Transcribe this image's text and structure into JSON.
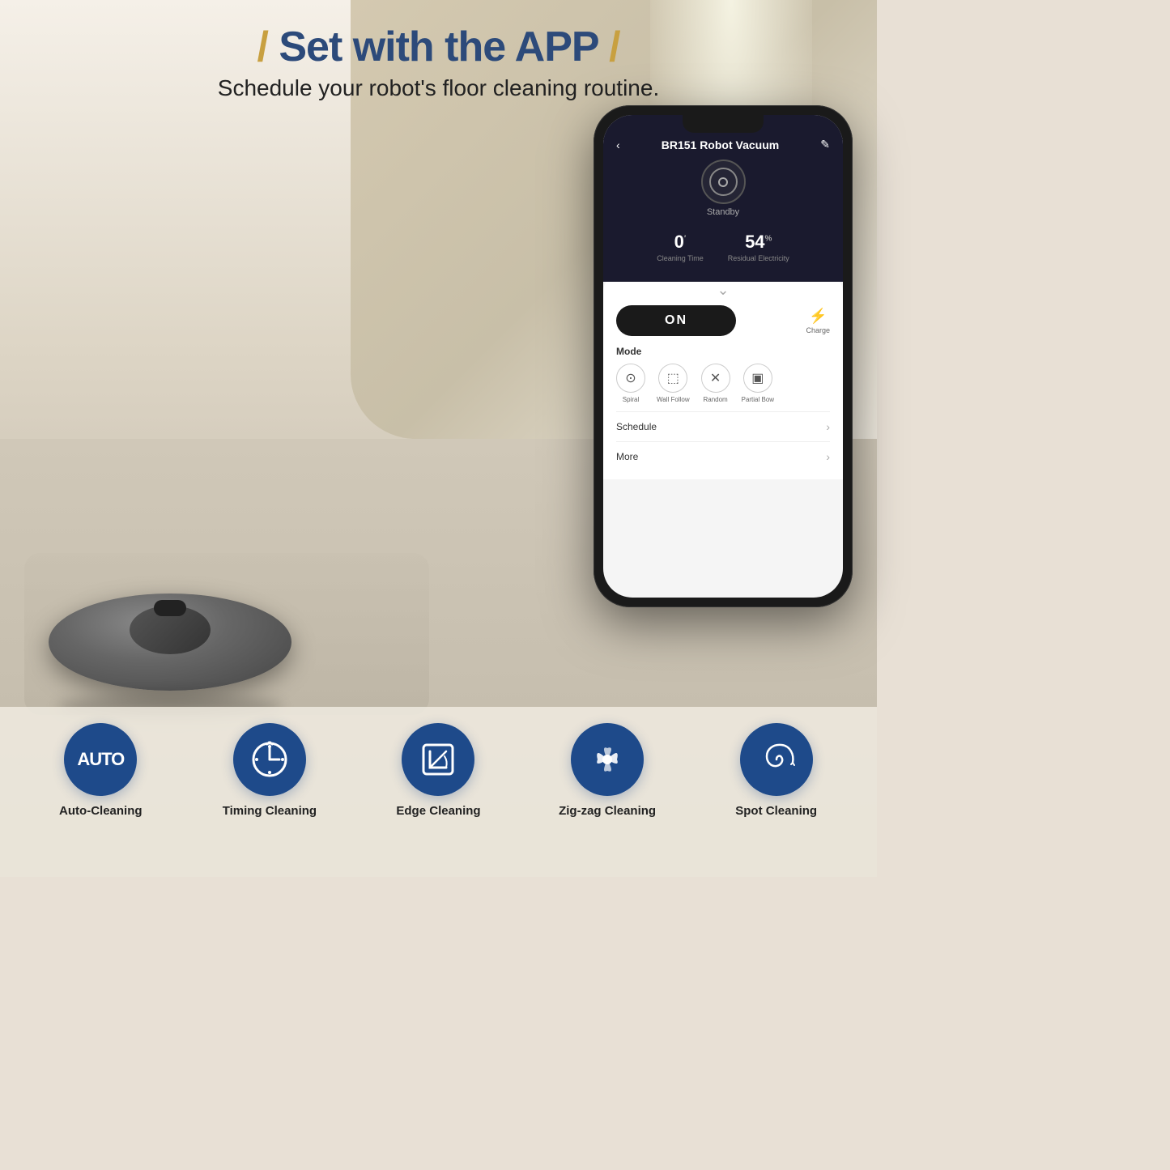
{
  "header": {
    "title_prefix": "/ Set with the APP /",
    "title_main": "Set with the APP",
    "slash_left": "/",
    "slash_right": "/",
    "subtitle": "Schedule your robot's floor cleaning routine."
  },
  "phone": {
    "device_name": "BR151 Robot Vacuum",
    "status": "Standby",
    "cleaning_time_value": "0",
    "cleaning_time_unit": "′",
    "cleaning_time_label": "Cleaning Time",
    "electricity_value": "54",
    "electricity_unit": "%",
    "electricity_label": "Residual Electricity",
    "on_button": "ON",
    "charge_label": "Charge",
    "mode_section_title": "Mode",
    "modes": [
      {
        "icon": "⊙",
        "label": "Spiral"
      },
      {
        "icon": "⬚",
        "label": "Wall Follow"
      },
      {
        "icon": "✕",
        "label": "Random"
      },
      {
        "icon": "▣",
        "label": "Partial Bow"
      }
    ],
    "schedule_label": "Schedule",
    "more_label": "More"
  },
  "features": [
    {
      "icon_type": "auto-text",
      "icon_text": "AUTO",
      "label": "Auto-Cleaning"
    },
    {
      "icon_type": "clock",
      "label": "Timing Cleaning"
    },
    {
      "icon_type": "edge",
      "label": "Edge Cleaning"
    },
    {
      "icon_type": "zigzag",
      "label": "Zig-zag Cleaning"
    },
    {
      "icon_type": "spot",
      "label": "Spot Cleaning"
    }
  ],
  "colors": {
    "blue_dark": "#2c4a7a",
    "blue_accent": "#1e4a8a",
    "gold": "#c8a040",
    "text_dark": "#222222"
  }
}
